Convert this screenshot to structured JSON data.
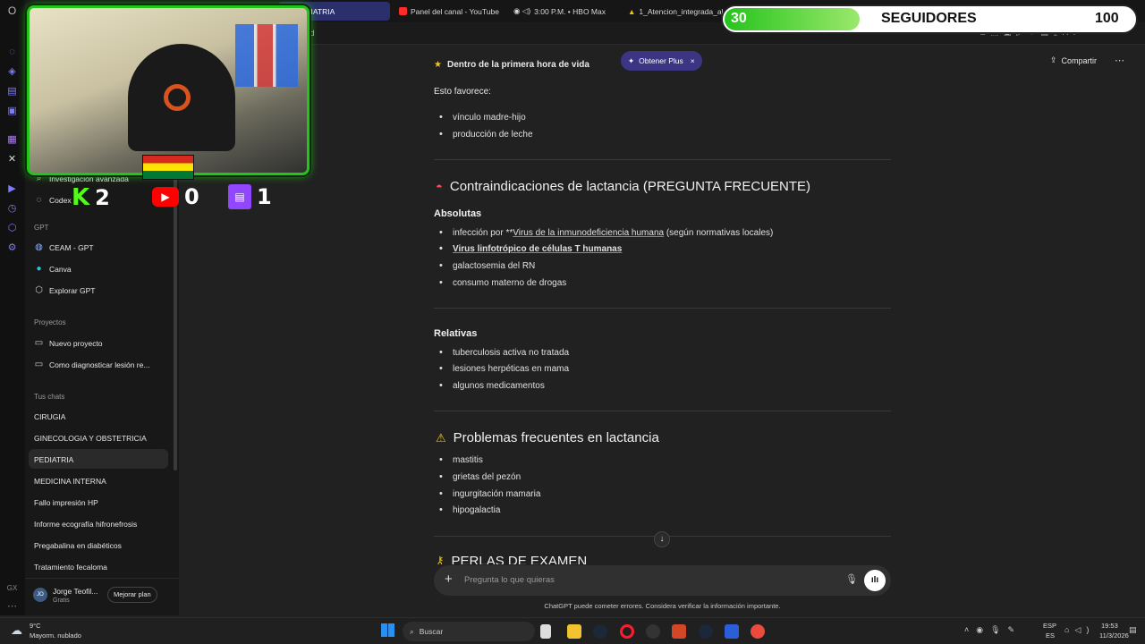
{
  "browser": {
    "tabs": [
      {
        "label": "PEDIATRIA",
        "active": true
      },
      {
        "label": "Panel del canal - YouTube",
        "active": false
      },
      {
        "label": "3:00 P.M. • HBO Max",
        "active": false
      },
      {
        "label": "1_Atencion_integrada_al",
        "active": false
      }
    ],
    "address_fragment": "cd"
  },
  "sidebar": {
    "top_items": [
      {
        "label": "Investigación avanzada",
        "icon": "telescope-icon"
      },
      {
        "label": "Codex",
        "icon": "codex-icon"
      }
    ],
    "gpt_section": "GPT",
    "gpt_items": [
      {
        "label": "CEAM - GPT",
        "icon": "globe-icon"
      },
      {
        "label": "Canva",
        "icon": "canva-icon"
      },
      {
        "label": "Explorar GPT",
        "icon": "cube-icon"
      }
    ],
    "projects_section": "Proyectos",
    "project_items": [
      {
        "label": "Nuevo proyecto",
        "icon": "folder-plus-icon"
      },
      {
        "label": "Como diagnosticar lesión re...",
        "icon": "folder-icon"
      }
    ],
    "chats_section": "Tus chats",
    "chats": [
      "CIRUGIA",
      "GINECOLOGIA Y OBSTETRICIA",
      "PEDIATRIA",
      "MEDICINA INTERNA",
      "Fallo impresión HP",
      "Informe ecografía hifronefrosis",
      "Pregabalina en diabéticos",
      "Tratamiento fecaloma"
    ],
    "selected_chat": "PEDIATRIA",
    "user": {
      "initials": "JO",
      "name": "Jorge Teofil...",
      "plan": "Gratis",
      "upgrade_label": "Mejorar plan"
    }
  },
  "header": {
    "obtain_plus": "Obtener Plus",
    "share": "Compartir"
  },
  "content": {
    "top_heading": "Dentro de la primera hora de vida",
    "favors": "Esto favorece:",
    "favor_items": [
      "vínculo madre-hijo",
      "producción de leche"
    ],
    "contra_title": "Contraindicaciones de lactancia (PREGUNTA FRECUENTE)",
    "absolutas": "Absolutas",
    "abs_item1_pre": "infección por **",
    "abs_item1_link": "Virus de la inmunodeficiencia humana",
    "abs_item1_post": " (según normativas locales)",
    "abs_item2": "Virus linfotrópico de células T humanas",
    "abs_items_rest": [
      "galactosemia del RN",
      "consumo materno de drogas"
    ],
    "relativas": "Relativas",
    "rel_items": [
      "tuberculosis activa no tratada",
      "lesiones herpéticas en mama",
      "algunos medicamentos"
    ],
    "problems_title": "Problemas frecuentes en lactancia",
    "problem_items": [
      "mastitis",
      "grietas del pezón",
      "ingurgitación mamaria",
      "hipogalactia"
    ],
    "perlas_title": "PERLAS DE EXAMEN"
  },
  "composer": {
    "placeholder": "Pregunta lo que quieras",
    "disclaimer": "ChatGPT puede cometer errores. Considera verificar la información importante."
  },
  "overlay": {
    "kick_count": "2",
    "youtube_count": "0",
    "twitch_count": "1",
    "followers_current": "30",
    "followers_label": "SEGUIDORES",
    "followers_goal": "100",
    "followers_progress": 0.3
  },
  "taskbar": {
    "weather_temp": "9°C",
    "weather_desc": "Mayorm. nublado",
    "search": "Buscar",
    "lang_top": "ESP",
    "lang_bottom": "ES",
    "time": "19:53",
    "date": "11/3/2026"
  },
  "colors": {
    "accent_green": "#25c41c",
    "plus_purple": "#3b3584",
    "bg_main": "#212121"
  }
}
